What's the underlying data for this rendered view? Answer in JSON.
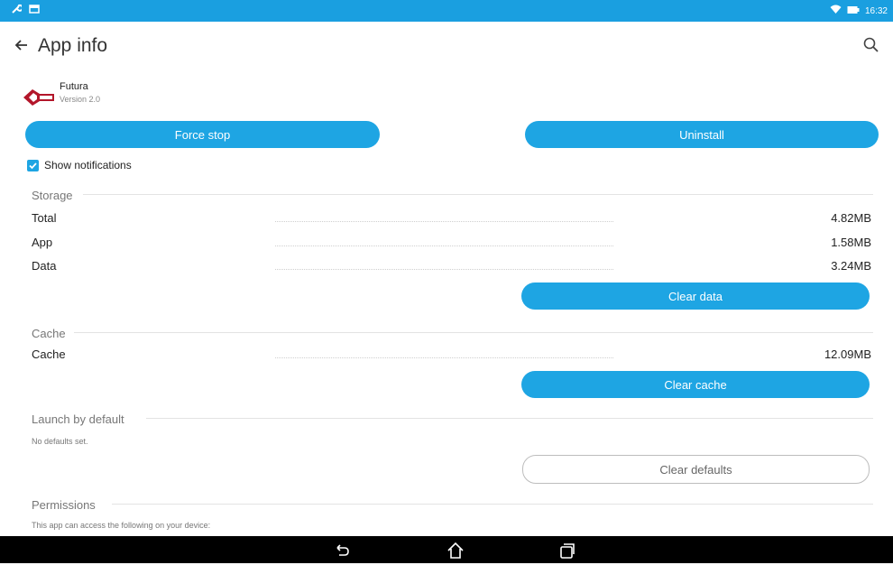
{
  "status_bar": {
    "time": "16:32"
  },
  "app_bar": {
    "title": "App info"
  },
  "app": {
    "name": "Futura",
    "version": "Version 2.0"
  },
  "buttons": {
    "force_stop": "Force stop",
    "uninstall": "Uninstall",
    "clear_data": "Clear data",
    "clear_cache": "Clear cache",
    "clear_defaults": "Clear defaults"
  },
  "notifications": {
    "label": "Show notifications",
    "checked": true
  },
  "storage": {
    "heading": "Storage",
    "rows": [
      {
        "label": "Total",
        "value": "4.82MB"
      },
      {
        "label": "App",
        "value": "1.58MB"
      },
      {
        "label": "Data",
        "value": "3.24MB"
      }
    ]
  },
  "cache": {
    "heading": "Cache",
    "rows": [
      {
        "label": "Cache",
        "value": "12.09MB"
      }
    ]
  },
  "launch": {
    "heading": "Launch by default",
    "note": "No defaults set."
  },
  "permissions": {
    "heading": "Permissions",
    "note": "This app can access the following on your device:"
  },
  "colors": {
    "accent": "#1ea5e3",
    "status_bar": "#1a9fe0",
    "nav_bar": "#000000"
  }
}
